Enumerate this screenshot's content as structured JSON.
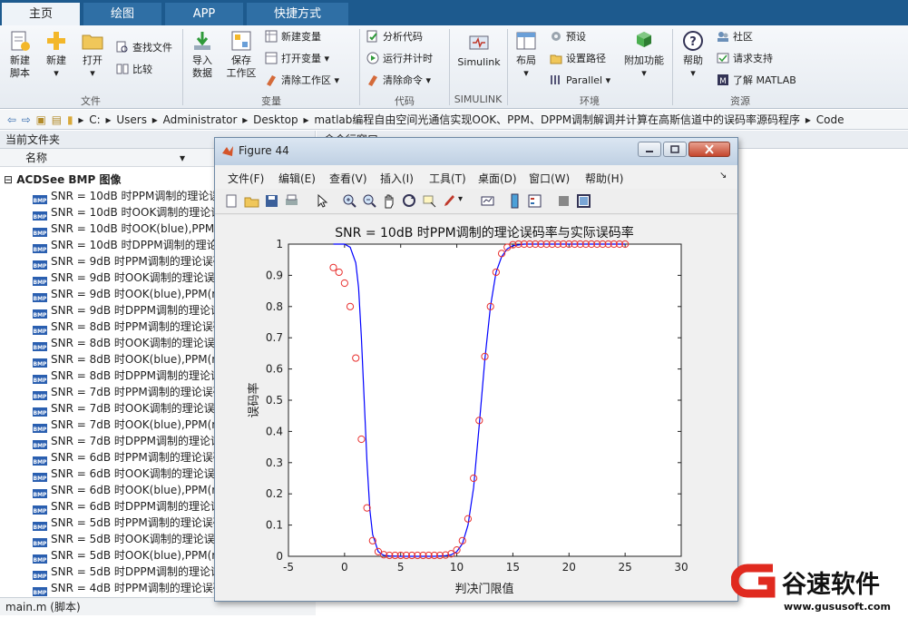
{
  "tabs": [
    "主页",
    "绘图",
    "APP",
    "快捷方式"
  ],
  "ribbon": {
    "file": {
      "new_script": "新建\n脚本",
      "new": "新建",
      "open": "打开",
      "find_files": "查找文件",
      "compare": "比较",
      "group": "文件"
    },
    "variable": {
      "import": "导入\n数据",
      "save_ws": "保存\n工作区",
      "new_var": "新建变量",
      "open_var": "打开变量",
      "clear_ws": "清除工作区",
      "group": "变量"
    },
    "code": {
      "analyze": "分析代码",
      "run_time": "运行并计时",
      "clear_cmd": "清除命令",
      "group": "代码"
    },
    "simulink": {
      "label": "Simulink",
      "group": "SIMULINK"
    },
    "env": {
      "layout": "布局",
      "prefs": "预设",
      "set_path": "设置路径",
      "parallel": "Parallel",
      "addons": "附加功能",
      "group": "环境"
    },
    "resources": {
      "help": "帮助",
      "community": "社区",
      "support": "请求支持",
      "learn": "了解 MATLAB",
      "group": "资源"
    }
  },
  "address": {
    "path": [
      "C:",
      "Users",
      "Administrator",
      "Desktop",
      "matlab编程自由空间光通信实现OOK、PPM、DPPM调制解调并计算在高斯信道中的误码率源码程序",
      "Code"
    ]
  },
  "current_folder": {
    "title": "当前文件夹",
    "column_name": "名称",
    "group": "ACDSee BMP 图像",
    "files": [
      "SNR = 10dB 时PPM调制的理论误码率与实际误码率",
      "SNR = 10dB 时OOK调制的理论误码率与实际误码率",
      "SNR = 10dB 时OOK(blue),PPM(red)",
      "SNR = 10dB 时DPPM调制的理论误码率与实际误码率",
      "SNR = 9dB 时PPM调制的理论误码率与实际误码率",
      "SNR = 9dB 时OOK调制的理论误码率与实际误码率",
      "SNR = 9dB 时OOK(blue),PPM(red)",
      "SNR = 9dB 时DPPM调制的理论误码率与实际误码率",
      "SNR = 8dB 时PPM调制的理论误码率与实际误码率",
      "SNR = 8dB 时OOK调制的理论误码率与实际误码率",
      "SNR = 8dB 时OOK(blue),PPM(red)",
      "SNR = 8dB 时DPPM调制的理论误码率与实际误码率",
      "SNR = 7dB 时PPM调制的理论误码率与实际误码率",
      "SNR = 7dB 时OOK调制的理论误码率与实际误码率",
      "SNR = 7dB 时OOK(blue),PPM(red)",
      "SNR = 7dB 时DPPM调制的理论误码率与实际误码率",
      "SNR = 6dB 时PPM调制的理论误码率与实际误码率",
      "SNR = 6dB 时OOK调制的理论误码率与实际误码率",
      "SNR = 6dB 时OOK(blue),PPM(red)",
      "SNR = 6dB 时DPPM调制的理论误码率与实际误码率",
      "SNR = 5dB 时PPM调制的理论误码率与实际误码率",
      "SNR = 5dB 时OOK调制的理论误码率与实际误码率",
      "SNR = 5dB 时OOK(blue),PPM(red)",
      "SNR = 5dB 时DPPM调制的理论误码率与实际误码率",
      "SNR = 4dB 时PPM调制的理论误码率与实际误码率"
    ],
    "status": "main.m  (脚本)"
  },
  "command_window": {
    "title": "命令行窗口"
  },
  "figure": {
    "window_title": "Figure 44",
    "menu": [
      "文件(F)",
      "编辑(E)",
      "查看(V)",
      "插入(I)",
      "工具(T)",
      "桌面(D)",
      "窗口(W)",
      "帮助(H)"
    ]
  },
  "chart_data": {
    "type": "line",
    "title": "SNR = 10dB 时PPM调制的理论误码率与实际误码率",
    "xlabel": "判决门限值",
    "ylabel": "误码率",
    "xlim": [
      -5,
      30
    ],
    "ylim": [
      0,
      1
    ],
    "xticks": [
      -5,
      0,
      5,
      10,
      15,
      20,
      25,
      30
    ],
    "yticks": [
      0,
      0.1,
      0.2,
      0.3,
      0.4,
      0.5,
      0.6,
      0.7,
      0.8,
      0.9,
      1
    ],
    "grid": false,
    "series": [
      {
        "style": "blue-line",
        "color": "#0000ff",
        "x": [
          -1,
          0,
          0.5,
          1,
          1.25,
          1.5,
          1.75,
          2,
          2.25,
          2.5,
          3,
          3.5,
          4,
          5,
          6,
          7,
          8,
          9,
          9.5,
          10,
          10.5,
          11,
          11.5,
          12,
          12.5,
          13,
          13.5,
          14,
          14.5,
          15,
          16,
          18,
          20,
          25
        ],
        "y": [
          1,
          1,
          0.99,
          0.94,
          0.86,
          0.7,
          0.5,
          0.3,
          0.15,
          0.07,
          0.015,
          0.003,
          0.001,
          0,
          0,
          0,
          0,
          0.002,
          0.005,
          0.015,
          0.04,
          0.1,
          0.22,
          0.42,
          0.63,
          0.8,
          0.91,
          0.96,
          0.985,
          0.995,
          1,
          1,
          1,
          1
        ]
      },
      {
        "style": "red-circles",
        "color": "#e8312f",
        "x": [
          -1,
          -0.5,
          0,
          0.5,
          1,
          1.5,
          2,
          2.5,
          3,
          3.5,
          4,
          4.5,
          5,
          5.5,
          6,
          6.5,
          7,
          7.5,
          8,
          8.5,
          9,
          9.5,
          10,
          10.5,
          11,
          11.5,
          12,
          12.5,
          13,
          13.5,
          14,
          14.5,
          15,
          15.5,
          16,
          16.5,
          17,
          17.5,
          18,
          18.5,
          19,
          19.5,
          20,
          20.5,
          21,
          21.5,
          22,
          22.5,
          23,
          23.5,
          24,
          24.5,
          25
        ],
        "y": [
          0.925,
          0.91,
          0.875,
          0.8,
          0.635,
          0.375,
          0.155,
          0.05,
          0.015,
          0.005,
          0.003,
          0.003,
          0.003,
          0.003,
          0.003,
          0.003,
          0.003,
          0.003,
          0.003,
          0.003,
          0.004,
          0.008,
          0.02,
          0.05,
          0.12,
          0.25,
          0.435,
          0.64,
          0.8,
          0.91,
          0.97,
          0.99,
          0.998,
          1,
          1,
          1,
          1,
          1,
          1,
          1,
          1,
          1,
          1,
          1,
          1,
          1,
          1,
          1,
          1,
          1,
          1,
          1,
          1
        ]
      }
    ]
  },
  "logo": {
    "text": "谷速软件",
    "url_text": "www.gususoft.com"
  },
  "colors": {
    "ribbon_blue": "#1d5a8e",
    "plot_blue": "#0000ff",
    "plot_red": "#e8312f",
    "logo_red": "#e02a1f"
  }
}
